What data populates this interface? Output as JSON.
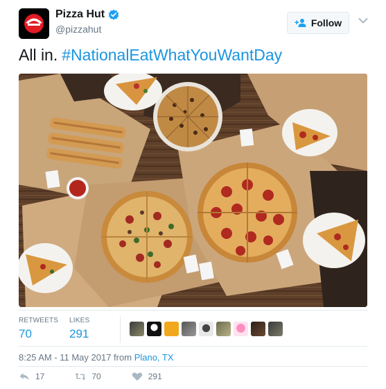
{
  "tweet": {
    "display_name": "Pizza Hut",
    "handle": "@pizzahut",
    "follow_label": "Follow",
    "text_lead": "All in.",
    "hashtag": "#NationalEatWhatYouWantDay"
  },
  "stats": {
    "retweets_label": "RETWEETS",
    "retweets_count": "70",
    "likes_label": "LIKES",
    "likes_count": "291"
  },
  "timestamp": {
    "time": "8:25 AM - 11 May 2017 from",
    "place": "Plano, TX"
  },
  "actions": {
    "reply_count": "17",
    "retweet_count": "70",
    "like_count": "291"
  },
  "colors": {
    "link": "#1b95e0",
    "muted": "#657786",
    "brand_red": "#e21b24"
  },
  "icons": {
    "verified": "verified-badge-icon",
    "follow": "add-user-icon",
    "caret": "chevron-down-icon",
    "reply": "reply-icon",
    "retweet": "retweet-icon",
    "like": "heart-icon"
  }
}
